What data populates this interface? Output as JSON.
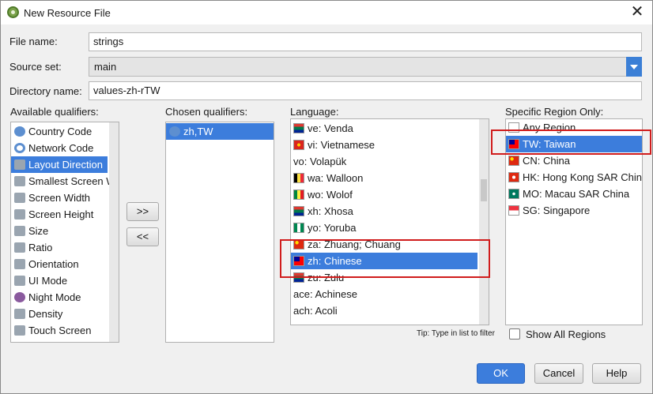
{
  "window": {
    "title": "New Resource File",
    "close_glyph": "✕"
  },
  "form": {
    "file_name_label": "File name:",
    "file_name_value": "strings",
    "source_set_label": "Source set:",
    "source_set_value": "main",
    "directory_label": "Directory name:",
    "directory_value": "values-zh-rTW"
  },
  "qualifiers": {
    "available_label": "Available qualifiers:",
    "available": [
      {
        "label": "Country Code",
        "icon": "globe-icon"
      },
      {
        "label": "Network Code",
        "icon": "network-icon"
      },
      {
        "label": "Layout Direction",
        "icon": "layout-direction-icon",
        "selected": true
      },
      {
        "label": "Smallest Screen W",
        "icon": "smallest-width-icon"
      },
      {
        "label": "Screen Width",
        "icon": "screen-width-icon"
      },
      {
        "label": "Screen Height",
        "icon": "screen-height-icon"
      },
      {
        "label": "Size",
        "icon": "size-icon"
      },
      {
        "label": "Ratio",
        "icon": "ratio-icon"
      },
      {
        "label": "Orientation",
        "icon": "orientation-icon"
      },
      {
        "label": "UI Mode",
        "icon": "ui-mode-icon"
      },
      {
        "label": "Night Mode",
        "icon": "night-mode-icon"
      },
      {
        "label": "Density",
        "icon": "density-icon"
      },
      {
        "label": "Touch Screen",
        "icon": "touch-screen-icon"
      }
    ],
    "chosen_label": "Chosen qualifiers:",
    "chosen": [
      {
        "label": "zh,TW",
        "icon": "globe-icon"
      }
    ],
    "add_button": ">>",
    "remove_button": "<<"
  },
  "language": {
    "label": "Language:",
    "items": [
      {
        "label": "ve: Venda",
        "flag": "za"
      },
      {
        "label": "vi: Vietnamese",
        "flag": "vn"
      },
      {
        "label": "vo: Volapük",
        "flag": ""
      },
      {
        "label": "wa: Walloon",
        "flag": "be"
      },
      {
        "label": "wo: Wolof",
        "flag": "sn"
      },
      {
        "label": "xh: Xhosa",
        "flag": "za"
      },
      {
        "label": "yo: Yoruba",
        "flag": "ng"
      },
      {
        "label": "za: Zhuang; Chuang",
        "flag": "cn"
      },
      {
        "label": "zh: Chinese",
        "flag": "tw",
        "selected": true
      },
      {
        "label": "zu: Zulu",
        "flag": "za"
      },
      {
        "label": "ace: Achinese",
        "flag": ""
      },
      {
        "label": "ach: Acoli",
        "flag": ""
      }
    ],
    "tip": "Tip: Type in list to filter"
  },
  "region": {
    "label": "Specific Region Only:",
    "items": [
      {
        "label": "Any Region",
        "flag": "none"
      },
      {
        "label": "TW: Taiwan",
        "flag": "tw",
        "selected": true
      },
      {
        "label": "CN: China",
        "flag": "cn"
      },
      {
        "label": "HK: Hong Kong SAR China",
        "flag": "hk"
      },
      {
        "label": "MO: Macau SAR China",
        "flag": "mo"
      },
      {
        "label": "SG: Singapore",
        "flag": "sg"
      }
    ],
    "show_all_label": "Show All Regions"
  },
  "buttons": {
    "ok": "OK",
    "cancel": "Cancel",
    "help": "Help"
  },
  "colors": {
    "selection": "#3c7ddc",
    "highlight": "#d01c1c",
    "accent": "#3b7fd6"
  }
}
